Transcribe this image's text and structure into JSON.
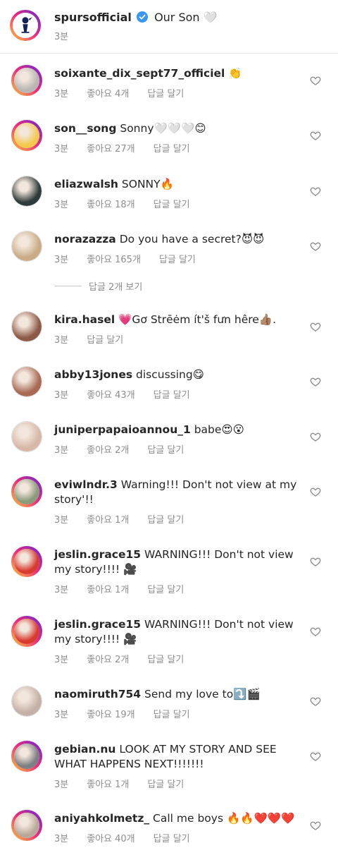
{
  "caption": {
    "username": "spursofficial",
    "text": "Our Son 🤍",
    "time": "3분"
  },
  "labels": {
    "like_prefix": "좋아요",
    "reply": "답글 달기"
  },
  "view_replies": "답글 2개 보기",
  "comments": [
    {
      "username": "soixante_dix_sept77_officiel",
      "text": "👏",
      "time": "3분",
      "likes": "4개",
      "avatar": "#b9b6b3"
    },
    {
      "username": "son__song",
      "text": "Sonny🤍🤍🤍😊",
      "time": "3분",
      "likes": "27개",
      "avatar": "#f2c94c"
    },
    {
      "username": "eliazwalsh",
      "text": "SONNY🔥",
      "time": "3분",
      "likes": "18개",
      "avatar": "#2e3b3a"
    },
    {
      "username": "norazazza",
      "text": "Do you have a secret?😈😈",
      "time": "3분",
      "likes": "165개",
      "avatar": "#c9ac87"
    },
    {
      "username": "kira.hasel",
      "text": "💗Gơ Strēėm ít'š fưn hêre👍🏽.",
      "time": "3분",
      "likes": "",
      "avatar": "#8c5a47"
    },
    {
      "username": "abby13jones",
      "text": "discussing😋",
      "time": "3분",
      "likes": "43개",
      "avatar": "#a86a55"
    },
    {
      "username": "juniperpapaioannou_1",
      "text": "babe😍😮",
      "time": "3분",
      "likes": "2개",
      "avatar": "#d7b8a8"
    },
    {
      "username": "eviwlndr.3",
      "text": "Warning!!! Don't not view at my story'!!",
      "time": "3분",
      "likes": "1개",
      "avatar": "#8a9a7a"
    },
    {
      "username": "jeslin.grace15",
      "text": "WARNING!!! Don't not view my story!!!! 🎥",
      "time": "3분",
      "likes": "1개",
      "avatar": "#d83a2f"
    },
    {
      "username": "jeslin.grace15",
      "text": "WARNING!!! Don't not view my story!!!! 🎥",
      "time": "3분",
      "likes": "2개",
      "avatar": "#d83a2f"
    },
    {
      "username": "naomiruth754",
      "text": "Send my love to⤵️🎬",
      "time": "3분",
      "likes": "19개",
      "avatar": "#c4b0a6"
    },
    {
      "username": "gebian.nu",
      "text": "LOOK AT MY STORY AND SEE WHAT HAPPENS NEXT!!!!!!!",
      "time": "3분",
      "likes": "1개",
      "avatar": "#7d7f82"
    },
    {
      "username": "aniyahkolmetz_",
      "text": "Call me boys 🔥🔥❤️❤️❤️",
      "time": "3분",
      "likes": "40개",
      "avatar": "#b8a89a"
    }
  ]
}
